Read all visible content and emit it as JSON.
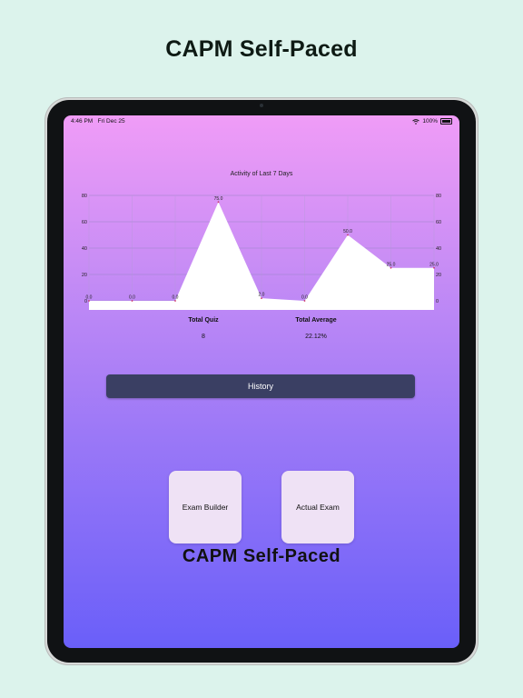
{
  "promo": {
    "title": "CAPM Self-Paced"
  },
  "status_bar": {
    "time": "4:46 PM",
    "date": "Fri Dec 25",
    "battery": "100%"
  },
  "chart_data": {
    "type": "area",
    "title": "Activity of Last 7 Days",
    "x": [
      1,
      2,
      3,
      4,
      5,
      6,
      7,
      8,
      9
    ],
    "values": [
      0,
      0,
      0,
      75,
      2,
      0,
      50,
      25,
      25
    ],
    "point_labels": [
      "0.0",
      "0.0",
      "0.0",
      "75.0",
      "2.0",
      "0.0",
      "50.0",
      "25.0",
      "25.0"
    ],
    "ylim": [
      0,
      80
    ],
    "yticks": [
      0,
      20,
      40,
      60,
      80
    ],
    "grid": true,
    "fill": "#ffffff"
  },
  "stats": {
    "total_quiz_label": "Total Quiz",
    "total_quiz_value": "8",
    "total_average_label": "Total Average",
    "total_average_value": "22.12%"
  },
  "history_label": "History",
  "tiles": {
    "exam_builder": "Exam Builder",
    "actual_exam": "Actual Exam"
  },
  "app_name": "CAPM Self-Paced",
  "colors": {
    "history_button": "#3a3f63",
    "tile_bg": "#efe2f5",
    "gradient_top": "#f09cf7",
    "gradient_bottom": "#6a5ff9"
  }
}
